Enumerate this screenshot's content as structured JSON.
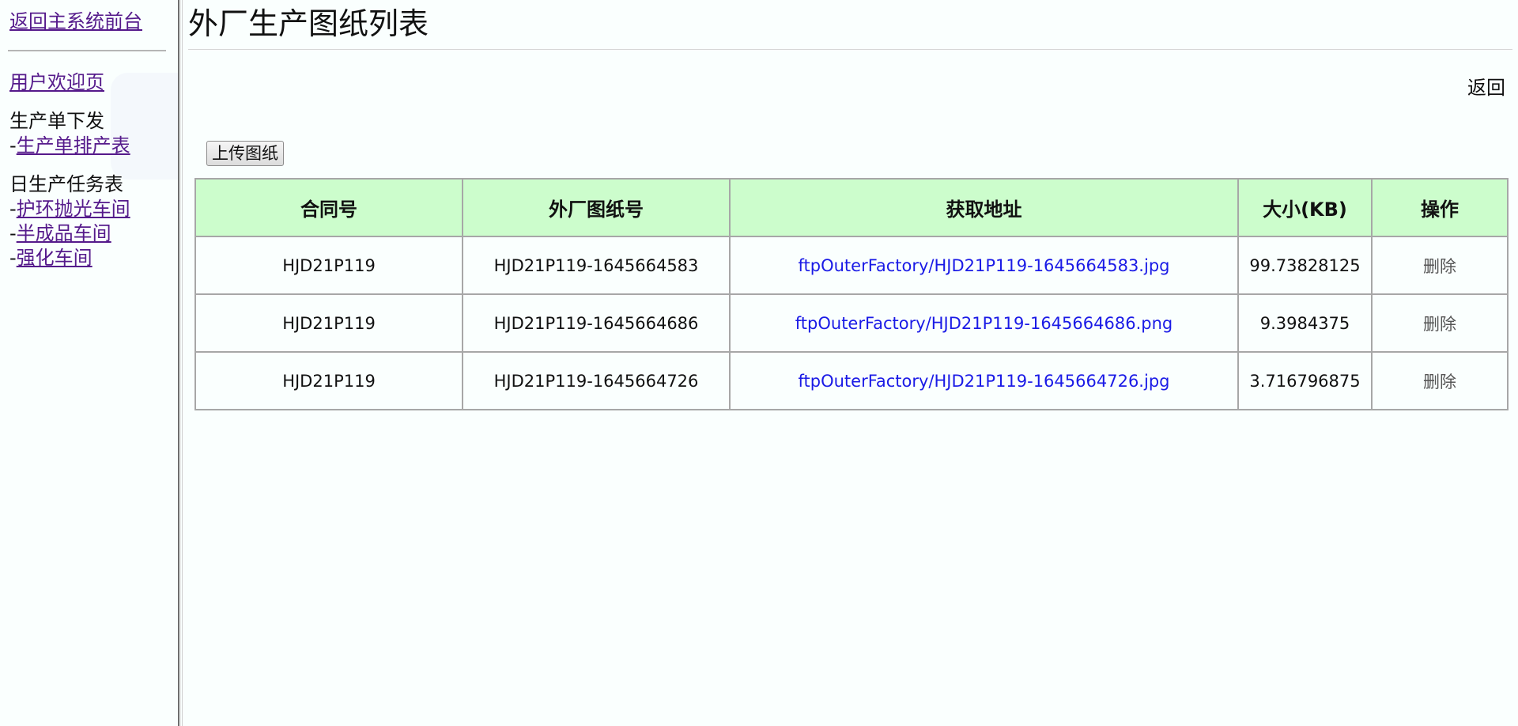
{
  "sidebar": {
    "back_to_main": "返回主系统前台",
    "welcome": "用户欢迎页",
    "groups": [
      {
        "title": "生产单下发",
        "items": [
          {
            "prefix": "-",
            "label": "生产单排产表"
          }
        ]
      },
      {
        "title": "日生产任务表",
        "items": [
          {
            "prefix": "-",
            "label": "护环抛光车间"
          },
          {
            "prefix": "-",
            "label": "半成品车间"
          },
          {
            "prefix": "-",
            "label": "强化车间"
          }
        ]
      }
    ]
  },
  "main": {
    "title": "外厂生产图纸列表",
    "back_label": "返回",
    "upload_label": "上传图纸",
    "table": {
      "headers": [
        "合同号",
        "外厂图纸号",
        "获取地址",
        "大小(KB)",
        "操作"
      ],
      "rows": [
        {
          "contract": "HJD21P119",
          "drawing_no": "HJD21P119-1645664583",
          "url": "ftpOuterFactory/HJD21P119-1645664583.jpg",
          "size": "99.73828125",
          "action": "删除"
        },
        {
          "contract": "HJD21P119",
          "drawing_no": "HJD21P119-1645664686",
          "url": "ftpOuterFactory/HJD21P119-1645664686.png",
          "size": "9.3984375",
          "action": "删除"
        },
        {
          "contract": "HJD21P119",
          "drawing_no": "HJD21P119-1645664726",
          "url": "ftpOuterFactory/HJD21P119-1645664726.jpg",
          "size": "3.716796875",
          "action": "删除"
        }
      ]
    }
  },
  "colors": {
    "background": "#fafffe",
    "link_visited": "#551a8b",
    "link_blue": "#1a1ae6",
    "header_green": "#ccfdcc",
    "table_border": "#a7a7a7"
  }
}
